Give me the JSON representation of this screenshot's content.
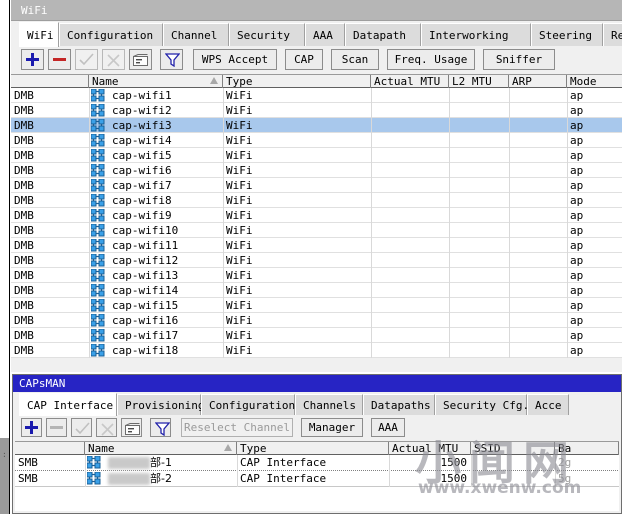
{
  "wifi_window": {
    "title": "WiFi",
    "tabs": [
      {
        "label": "WiFi",
        "active": true
      },
      {
        "label": "Configuration",
        "active": false
      },
      {
        "label": "Channel",
        "active": false
      },
      {
        "label": "Security",
        "active": false
      },
      {
        "label": "AAA",
        "active": false
      },
      {
        "label": "Datapath",
        "active": false
      },
      {
        "label": "Interworking",
        "active": false
      },
      {
        "label": "Steering",
        "active": false
      },
      {
        "label": "Registr",
        "active": false
      }
    ],
    "toolbar": {
      "add_icon": "plus-icon",
      "remove_icon": "minus-icon",
      "enable_icon": "check-icon",
      "disable_icon": "cross-icon",
      "comment_icon": "comment-icon",
      "filter_icon": "funnel-icon",
      "buttons": [
        {
          "label": "WPS Accept"
        },
        {
          "label": "CAP"
        },
        {
          "label": "Scan"
        },
        {
          "label": "Freq. Usage"
        },
        {
          "label": "Sniffer"
        }
      ]
    },
    "columns": [
      "",
      "Name",
      "Type",
      "Actual MTU",
      "L2 MTU",
      "ARP",
      "Mode"
    ],
    "sorted_column": "Name",
    "rows": [
      {
        "flags": "DMB",
        "name": "cap-wifi1",
        "type": "WiFi",
        "actual_mtu": "",
        "l2_mtu": "",
        "arp": "",
        "mode": "ap",
        "selected": false
      },
      {
        "flags": "DMB",
        "name": "cap-wifi2",
        "type": "WiFi",
        "actual_mtu": "",
        "l2_mtu": "",
        "arp": "",
        "mode": "ap",
        "selected": false
      },
      {
        "flags": "DMB",
        "name": "cap-wifi3",
        "type": "WiFi",
        "actual_mtu": "",
        "l2_mtu": "",
        "arp": "",
        "mode": "ap",
        "selected": true
      },
      {
        "flags": "DMB",
        "name": "cap-wifi4",
        "type": "WiFi",
        "actual_mtu": "",
        "l2_mtu": "",
        "arp": "",
        "mode": "ap",
        "selected": false
      },
      {
        "flags": "DMB",
        "name": "cap-wifi5",
        "type": "WiFi",
        "actual_mtu": "",
        "l2_mtu": "",
        "arp": "",
        "mode": "ap",
        "selected": false
      },
      {
        "flags": "DMB",
        "name": "cap-wifi6",
        "type": "WiFi",
        "actual_mtu": "",
        "l2_mtu": "",
        "arp": "",
        "mode": "ap",
        "selected": false
      },
      {
        "flags": "DMB",
        "name": "cap-wifi7",
        "type": "WiFi",
        "actual_mtu": "",
        "l2_mtu": "",
        "arp": "",
        "mode": "ap",
        "selected": false
      },
      {
        "flags": "DMB",
        "name": "cap-wifi8",
        "type": "WiFi",
        "actual_mtu": "",
        "l2_mtu": "",
        "arp": "",
        "mode": "ap",
        "selected": false
      },
      {
        "flags": "DMB",
        "name": "cap-wifi9",
        "type": "WiFi",
        "actual_mtu": "",
        "l2_mtu": "",
        "arp": "",
        "mode": "ap",
        "selected": false
      },
      {
        "flags": "DMB",
        "name": "cap-wifi10",
        "type": "WiFi",
        "actual_mtu": "",
        "l2_mtu": "",
        "arp": "",
        "mode": "ap",
        "selected": false
      },
      {
        "flags": "DMB",
        "name": "cap-wifi11",
        "type": "WiFi",
        "actual_mtu": "",
        "l2_mtu": "",
        "arp": "",
        "mode": "ap",
        "selected": false
      },
      {
        "flags": "DMB",
        "name": "cap-wifi12",
        "type": "WiFi",
        "actual_mtu": "",
        "l2_mtu": "",
        "arp": "",
        "mode": "ap",
        "selected": false
      },
      {
        "flags": "DMB",
        "name": "cap-wifi13",
        "type": "WiFi",
        "actual_mtu": "",
        "l2_mtu": "",
        "arp": "",
        "mode": "ap",
        "selected": false
      },
      {
        "flags": "DMB",
        "name": "cap-wifi14",
        "type": "WiFi",
        "actual_mtu": "",
        "l2_mtu": "",
        "arp": "",
        "mode": "ap",
        "selected": false
      },
      {
        "flags": "DMB",
        "name": "cap-wifi15",
        "type": "WiFi",
        "actual_mtu": "",
        "l2_mtu": "",
        "arp": "",
        "mode": "ap",
        "selected": false
      },
      {
        "flags": "DMB",
        "name": "cap-wifi16",
        "type": "WiFi",
        "actual_mtu": "",
        "l2_mtu": "",
        "arp": "",
        "mode": "ap",
        "selected": false
      },
      {
        "flags": "DMB",
        "name": "cap-wifi17",
        "type": "WiFi",
        "actual_mtu": "",
        "l2_mtu": "",
        "arp": "",
        "mode": "ap",
        "selected": false
      },
      {
        "flags": "DMB",
        "name": "cap-wifi18",
        "type": "WiFi",
        "actual_mtu": "",
        "l2_mtu": "",
        "arp": "",
        "mode": "ap",
        "selected": false
      }
    ]
  },
  "capsman_window": {
    "title": "CAPsMAN",
    "tabs": [
      {
        "label": "CAP Interface",
        "active": true
      },
      {
        "label": "Provisioning",
        "active": false
      },
      {
        "label": "Configurations",
        "active": false
      },
      {
        "label": "Channels",
        "active": false
      },
      {
        "label": "Datapaths",
        "active": false
      },
      {
        "label": "Security Cfg.",
        "active": false
      },
      {
        "label": "Acce",
        "active": false
      }
    ],
    "toolbar": {
      "add_icon": "plus-icon",
      "remove_icon": "minus-icon",
      "enable_icon": "check-icon",
      "disable_icon": "cross-icon",
      "comment_icon": "comment-icon",
      "filter_icon": "funnel-icon",
      "buttons": [
        {
          "label": "Reselect Channel",
          "disabled": true
        },
        {
          "label": "Manager",
          "disabled": false
        },
        {
          "label": "AAA",
          "disabled": false
        }
      ]
    },
    "columns": [
      "",
      "Name",
      "Type",
      "Actual MTU",
      "SSID",
      "Ba"
    ],
    "sorted_column": "Name",
    "rows": [
      {
        "flags": "SMB",
        "name": "部-1",
        "type": "CAP Interface",
        "actual_mtu": "1500",
        "ssid": "",
        "band": "2g",
        "redacted": true
      },
      {
        "flags": "SMB",
        "name": "部-2",
        "type": "CAP Interface",
        "actual_mtu": "1500",
        "ssid": "",
        "band": "5g",
        "redacted": true
      }
    ]
  },
  "watermark": {
    "cjk": "小闻网",
    "url": "www.xwenw.com"
  },
  "colors": {
    "selection": "#a8c8ec",
    "capsman_titlebar": "#2724c4",
    "wifi_titlebar": "#b6b6b6",
    "add_icon": "#1a1aae",
    "remove_icon": "#c42626"
  }
}
